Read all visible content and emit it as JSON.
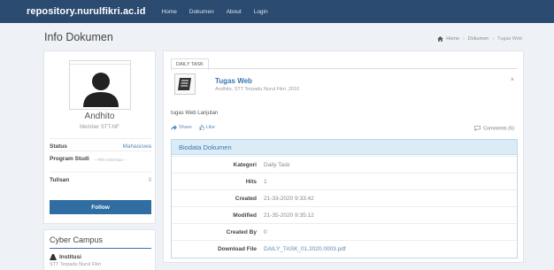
{
  "navbar": {
    "brand": "repository.nurulfikri.ac.id",
    "links": [
      "Home",
      "Dokumen",
      "About",
      "Login"
    ]
  },
  "header": {
    "title": "Info Dokumen",
    "breadcrumb": [
      "Home",
      "Dokumen",
      "Tugas Web"
    ]
  },
  "profile": {
    "name": "Andhito",
    "role": "Member STT-NF",
    "status_label": "Status",
    "status_value": "Mahasiswa",
    "prodi_label": "Program Studi",
    "prodi_sub": "-- Pilih Informasi --",
    "tulisan_label": "Tulisan",
    "tulisan_value": "3",
    "follow_label": "Follow"
  },
  "cyber": {
    "title": "Cyber Campus",
    "label": "Institusi",
    "sub": "STT Terpadu Nurul Fikri"
  },
  "main": {
    "tab": "DAILY TASK",
    "doc_title": "Tugas Web",
    "doc_meta": "Andhito, STT Terpadu Nurul Fikri ,2016",
    "close": "×",
    "description": "tugas Web Lanjutan",
    "share": "Share",
    "like": "Like",
    "comments": "Comments (5)",
    "bio_title": "Biodata Dokumen",
    "rows": [
      {
        "label": "Kategori",
        "value": "Daily Task"
      },
      {
        "label": "Hits",
        "value": "1"
      },
      {
        "label": "Created",
        "value": "21-33-2020 9:33:42"
      },
      {
        "label": "Modified",
        "value": "21-35-2020 9:35:12"
      },
      {
        "label": "Created By",
        "value": "0"
      },
      {
        "label": "Download File",
        "value": "DAILY_TASK_01.2020.0003.pdf"
      }
    ]
  },
  "colors": {
    "navbar": "#2b4a6f",
    "accent": "#2f6da3",
    "panel_head": "#dbecf7"
  },
  "icons": [
    "home-icon",
    "avatar-user-icon",
    "book-icon",
    "share-icon",
    "like-icon",
    "comment-icon",
    "institution-icon",
    "close-icon"
  ]
}
